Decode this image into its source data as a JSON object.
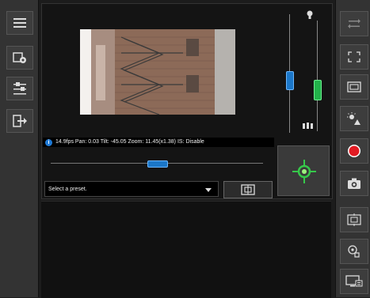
{
  "left_toolbar": {
    "buttons": [
      {
        "name": "menu-button",
        "icon": "hamburger-menu-icon"
      },
      {
        "name": "camera-settings-button",
        "icon": "camera-gear-icon"
      },
      {
        "name": "adjustments-button",
        "icon": "sliders-icon"
      },
      {
        "name": "logout-button",
        "icon": "exit-icon"
      }
    ]
  },
  "right_toolbar": {
    "buttons": [
      {
        "name": "swap-button",
        "icon": "swap-arrows-icon"
      },
      {
        "name": "fullscreen-button",
        "icon": "expand-arrows-icon"
      },
      {
        "name": "view-size-button",
        "icon": "screen-frame-icon"
      },
      {
        "name": "day-night-button",
        "icon": "sun-moon-icon"
      },
      {
        "name": "record-button",
        "icon": "record-circle-icon"
      },
      {
        "name": "snapshot-button",
        "icon": "camera-icon"
      },
      {
        "name": "capture-area-button",
        "icon": "capture-frame-icon"
      },
      {
        "name": "auto-focus-button",
        "icon": "focus-hand-icon"
      },
      {
        "name": "display-settings-button",
        "icon": "monitor-settings-icon"
      }
    ]
  },
  "status_bar": {
    "text": "14.9fps Pan: 0.03 Tilt: -45.05 Zoom: 11.45(x1.38) IS: Disable"
  },
  "zoom_slider": {
    "level": 0.5
  },
  "preset": {
    "placeholder": "Select a preset."
  },
  "sliders": {
    "blue_level": 0.55,
    "green_level": 0.45,
    "top_icon": "light-bulb-icon",
    "bottom_icon": "multi-light-icon"
  },
  "colors": {
    "accent_blue": "#1b77c9",
    "accent_green": "#22b24a",
    "record_red": "#e31b23",
    "info_blue": "#1f7ad6"
  }
}
